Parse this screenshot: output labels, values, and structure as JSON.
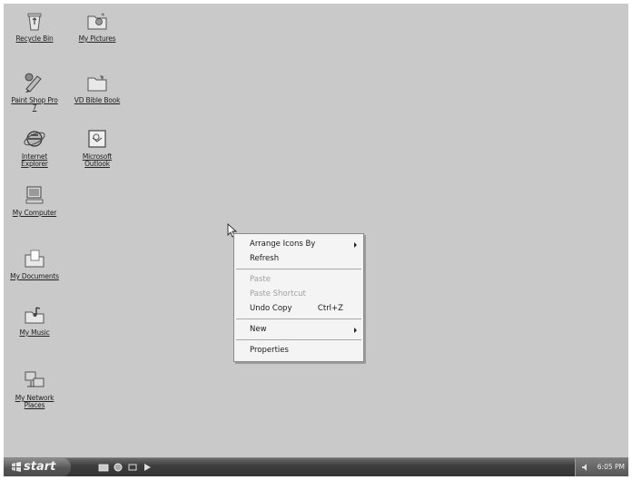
{
  "desktop_icons": [
    {
      "id": "recycle-bin",
      "label": "Recycle Bin",
      "icon": "recycle-bin-icon"
    },
    {
      "id": "my-pictures",
      "label": "My Pictures",
      "icon": "folder-pictures-icon"
    },
    {
      "id": "paint-shop-pro",
      "label": "Paint Shop Pro\n7",
      "icon": "paint-shop-pro-icon"
    },
    {
      "id": "bible-book",
      "label": "VD Bible Book",
      "icon": "folder-icon"
    },
    {
      "id": "internet-explorer",
      "label": "Internet\nExplorer",
      "icon": "internet-explorer-icon"
    },
    {
      "id": "outlook",
      "label": "Microsoft\nOutlook",
      "icon": "outlook-icon"
    },
    {
      "id": "my-computer",
      "label": "My Computer",
      "icon": "my-computer-icon"
    },
    {
      "id": "my-documents",
      "label": "My Documents",
      "icon": "my-documents-icon"
    },
    {
      "id": "my-music",
      "label": "My Music",
      "icon": "my-music-icon"
    },
    {
      "id": "my-network-places",
      "label": "My Network\nPlaces",
      "icon": "network-places-icon"
    }
  ],
  "context_menu": {
    "arrange_icons_by": "Arrange Icons By",
    "refresh": "Refresh",
    "paste": "Paste",
    "paste_shortcut": "Paste Shortcut",
    "undo_copy": "Undo Copy",
    "undo_copy_shortcut": "Ctrl+Z",
    "new": "New",
    "properties": "Properties"
  },
  "taskbar": {
    "start_label": "start",
    "clock": "6:05 PM",
    "quick_launch": [
      "show-desktop-icon",
      "internet-explorer-icon",
      "outlook-icon",
      "media-player-icon"
    ]
  }
}
